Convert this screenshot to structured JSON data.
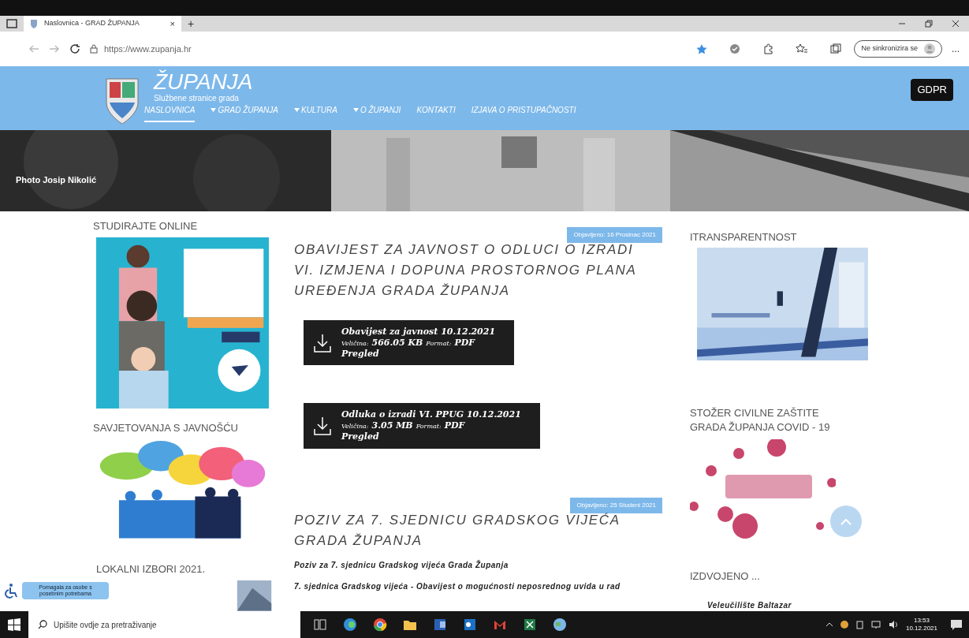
{
  "browser": {
    "tab_title": "Naslovnica - GRAD ŽUPANJA",
    "tab_close": "×",
    "new_tab": "+",
    "url": "https://www.zupanja.hr",
    "profile": "Ne sinkronizira se",
    "more": "..."
  },
  "header": {
    "site_title": "ŽUPANJA",
    "subtitle": "Službene stranice grada",
    "gdpr": "GDPR",
    "nav": [
      {
        "label": "NASLOVNICA",
        "dropdown": false,
        "selected": true
      },
      {
        "label": "GRAD ŽUPANJA",
        "dropdown": true,
        "selected": false
      },
      {
        "label": "KULTURA",
        "dropdown": true,
        "selected": false
      },
      {
        "label": "O ŽUPANJI",
        "dropdown": true,
        "selected": false
      },
      {
        "label": "KONTAKTI",
        "dropdown": false,
        "selected": false
      },
      {
        "label": "IZJAVA O PRISTUPAČNOSTI",
        "dropdown": false,
        "selected": false
      }
    ]
  },
  "hero": {
    "credit": "Photo Josip Nikolić"
  },
  "left_sidebar": [
    {
      "title": "STUDIRAJTE ONLINE"
    },
    {
      "title": "SAVJETOVANJA S JAVNOŠĆU"
    },
    {
      "title": "LOKALNI IZBORI 2021."
    }
  ],
  "articles": [
    {
      "date": "Objavljeno: 16 Prosinac 2021",
      "title": "OBAVIJEST ZA JAVNOST O ODLUCI O IZRADI VI. IZMJENA I DOPUNA PROSTORNOG PLANA UREĐENJA GRADA ŽUPANJA",
      "documents": [
        {
          "name": "Obavijest za javnost 10.12.2021",
          "size_label": "Veličina:",
          "size": "566.05 KB",
          "format_label": "Format:",
          "format": "PDF",
          "action": "Pregled"
        },
        {
          "name": "Odluka o izradi VI. PPUG 10.12.2021",
          "size_label": "Veličina:",
          "size": "3.05 MB",
          "format_label": "Format:",
          "format": "PDF",
          "action": "Pregled"
        }
      ]
    },
    {
      "date": "Objavljeno: 25 Studeni 2021",
      "title": "POZIV ZA 7. SJEDNICU GRADSKOG VIJEĆA GRADA ŽUPANJA",
      "paragraphs": [
        "**Poziv za 7. sjednicu Gradskog vijeća Grada Županja**",
        "7. sjednica Gradskog vijeća - Obavijest o mogućnosti neposrednog uvida u rad"
      ]
    }
  ],
  "right_sidebar": [
    {
      "title": "ITRANSPARENTNOST"
    },
    {
      "title": "STOŽER CIVILNE ZAŠTITE GRADA ŽUPANJA COVID - 19"
    },
    {
      "title": "IZDVOJENO ...",
      "links": [
        "Veleučilište Baltazar"
      ]
    }
  ],
  "accessibility": {
    "label": "Pomagala za osobe s posebnim potrebama"
  },
  "taskbar": {
    "search_placeholder": "Upišite ovdje za pretraživanje",
    "time": "13:53",
    "date": "10.12.2021"
  }
}
